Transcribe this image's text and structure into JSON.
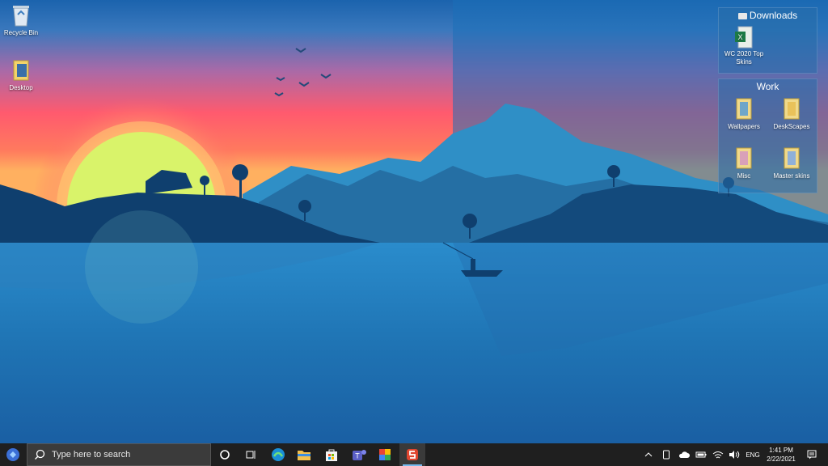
{
  "desktop": {
    "icons": [
      {
        "label": "Recycle Bin",
        "icon": "recycle-bin-icon"
      },
      {
        "label": "Desktop",
        "icon": "folder-icon"
      }
    ],
    "fences": [
      {
        "title": "Downloads",
        "items": [
          {
            "label": "WC 2020 Top Skins",
            "icon": "excel-file-icon"
          }
        ]
      },
      {
        "title": "Work",
        "items": [
          {
            "label": "Wallpapers",
            "icon": "folder-icon"
          },
          {
            "label": "DeskScapes",
            "icon": "folder-icon"
          },
          {
            "label": "Misc",
            "icon": "folder-icon"
          },
          {
            "label": "Master skins",
            "icon": "folder-icon"
          }
        ]
      }
    ]
  },
  "taskbar": {
    "search_placeholder": "Type here to search",
    "apps": [
      {
        "name": "edge",
        "icon": "edge-icon"
      },
      {
        "name": "file-explorer",
        "icon": "file-explorer-icon"
      },
      {
        "name": "store",
        "icon": "store-icon"
      },
      {
        "name": "teams",
        "icon": "teams-icon"
      },
      {
        "name": "app",
        "icon": "colorful-app-icon"
      },
      {
        "name": "stardock",
        "icon": "stardock-icon",
        "active": true
      }
    ],
    "tray": {
      "language": "ENG",
      "time": "1:41 PM",
      "date": "2/22/2021"
    }
  },
  "colors": {
    "taskbar_bg": "#1f1f1f",
    "accent": "#76b9ed",
    "sky_top": "#1e5da8",
    "sky_sunset": "#ff5a6a",
    "sun": "#d9f36a",
    "water": "#1d78b8"
  }
}
